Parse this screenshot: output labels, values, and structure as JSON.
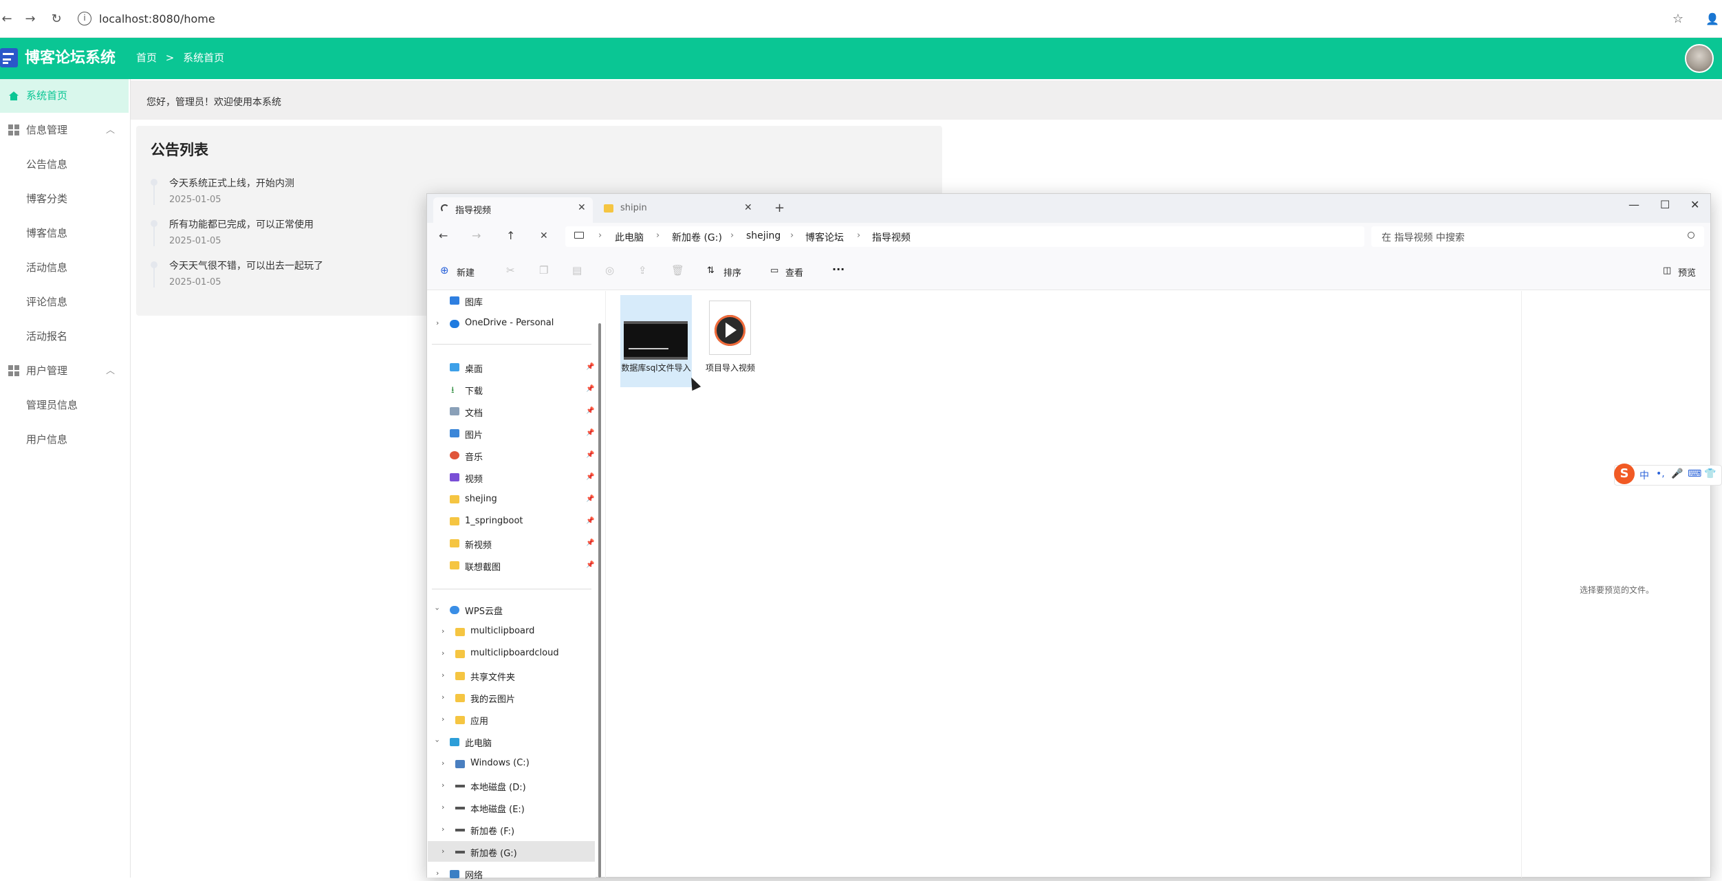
{
  "browser": {
    "url": "localhost:8080/home",
    "back_icon": "←",
    "forward_icon": "→",
    "reload_icon": "↻",
    "info_icon": "i",
    "star_icon": "☆",
    "profile_icon": "👤"
  },
  "app": {
    "title": "博客论坛系统",
    "breadcrumb": [
      "首页",
      "系统首页"
    ],
    "breadcrumb_sep": ">",
    "welcome": "您好，管理员！欢迎使用本系统",
    "accent_color": "#0ac694"
  },
  "sidebar": {
    "home": "系统首页",
    "group_info": "信息管理",
    "info_items": [
      "公告信息",
      "博客分类",
      "博客信息",
      "活动信息",
      "评论信息",
      "活动报名"
    ],
    "group_user": "用户管理",
    "user_items": [
      "管理员信息",
      "用户信息"
    ],
    "caret": "︿"
  },
  "notices": {
    "title": "公告列表",
    "items": [
      {
        "text": "今天系统正式上线，开始内测",
        "date": "2025-01-05"
      },
      {
        "text": "所有功能都已完成，可以正常使用",
        "date": "2025-01-05"
      },
      {
        "text": "今天天气很不错，可以出去一起玩了",
        "date": "2025-01-05"
      }
    ]
  },
  "explorer": {
    "tabs": [
      {
        "label": "指导视频",
        "close": "✕"
      },
      {
        "label": "shipin",
        "close": "✕"
      }
    ],
    "new_tab": "+",
    "window_controls": {
      "minimize": "—",
      "maximize": "☐",
      "close": "✕"
    },
    "nav": {
      "back": "←",
      "forward": "→",
      "up": "↑",
      "stop": "✕"
    },
    "address": [
      "此电脑",
      "新加卷 (G:)",
      "shejing",
      "博客论坛",
      "指导视频"
    ],
    "address_sep": "›",
    "search_placeholder": "在 指导视频 中搜索",
    "toolbar": {
      "new": "新建",
      "sort": "排序",
      "view": "查看",
      "more": "···",
      "preview": "预览"
    },
    "nav_pane": {
      "gallery": "图库",
      "onedrive": "OneDrive - Personal",
      "pinned": [
        "桌面",
        "下载",
        "文档",
        "图片",
        "音乐",
        "视频",
        "shejing",
        "1_springboot",
        "新视频",
        "联想截图"
      ],
      "wps": "WPS云盘",
      "wps_items": [
        "multiclipboard",
        "multiclipboardcloud",
        "共享文件夹",
        "我的云图片",
        "应用"
      ],
      "this_pc": "此电脑",
      "drives": [
        "Windows (C:)",
        "本地磁盘 (D:)",
        "本地磁盘 (E:)",
        "新加卷 (F:)",
        "新加卷 (G:)"
      ],
      "network": "网络"
    },
    "files": [
      {
        "name": "数据库sql文件导入"
      },
      {
        "name": "项目导入视频"
      }
    ],
    "preview_hint": "选择要预览的文件。"
  },
  "ime": {
    "logo": "S",
    "items": [
      "中",
      "•,",
      "🎤",
      "⌨",
      "👕"
    ]
  }
}
